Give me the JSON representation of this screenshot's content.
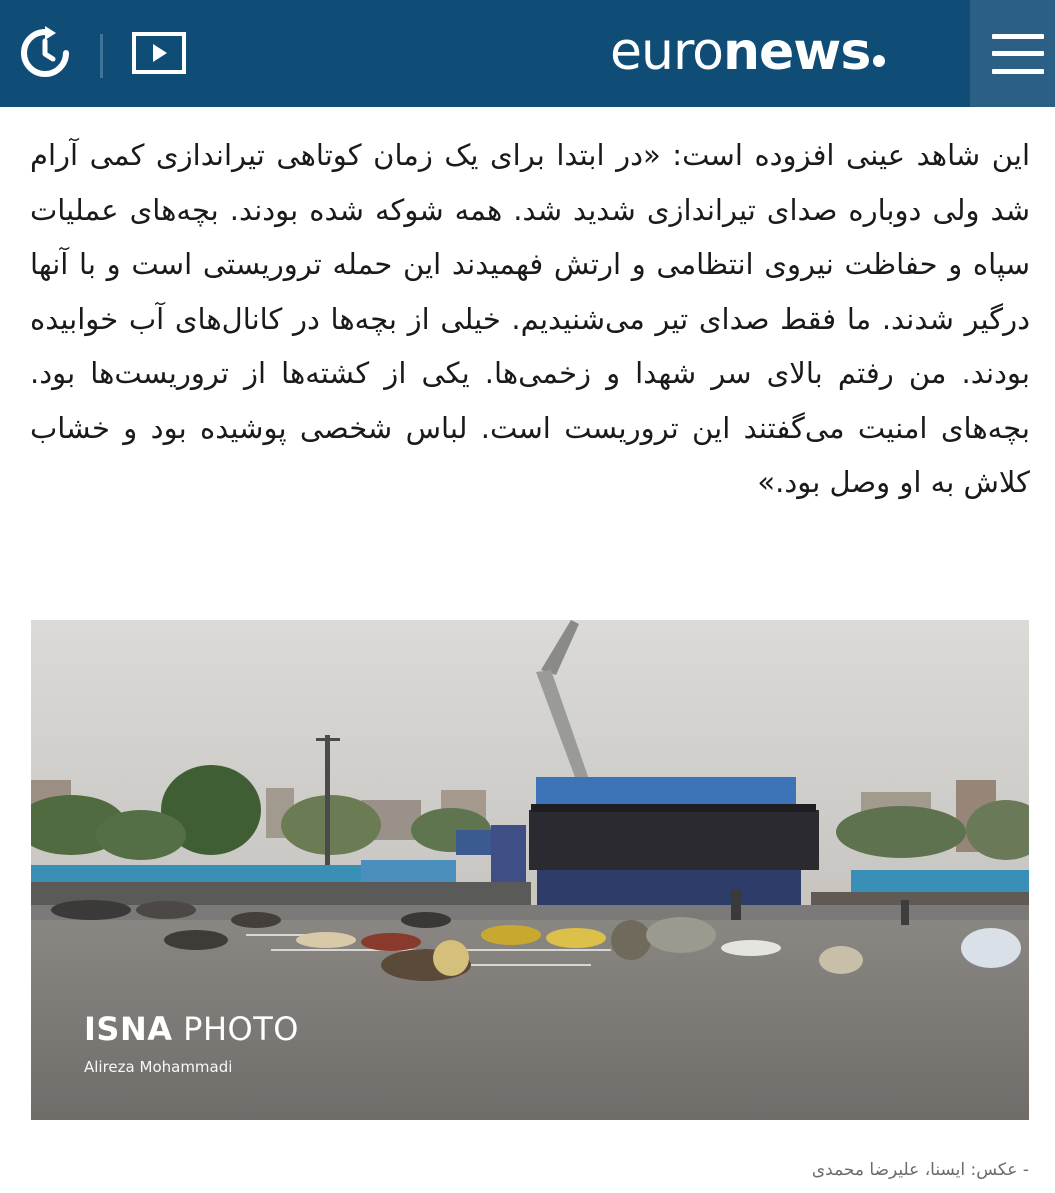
{
  "header": {
    "logo_light": "euro",
    "logo_bold": "news",
    "colors": {
      "bar": "#0f4d77",
      "menu_panel": "#2b5f86"
    },
    "icons": [
      "replay-icon",
      "video-play-icon",
      "hamburger-menu-icon"
    ]
  },
  "article": {
    "paragraph": "این شاهد عینی افزوده است: «در ابتدا برای یک زمان کوتاهی تیراندازی کمی آرام شد ولی دوباره صدای تیراندازی شدید شد. همه شوکه شده بودند. بچه‌های عملیات سپاه و حفاظت نیروی انتظامی و ارتش فهمیدند این حمله تروریستی است و با آنها درگیر شدند. ما فقط صدای تیر می‌شنیدیم. خیلی از بچه‌ها در کانال‌های آب خوابیده بودند. من رفتم بالای سر شهدا و زخمی‌ها. یکی از کشته‌ها از تروریست‌ها بود. بچه‌های امنیت می‌گفتند این تروریست است. لباس شخصی پوشیده بود و خشاب کلاش به او وصل بود.»"
  },
  "photo": {
    "watermark_bold": "ISNA",
    "watermark_light": " PHOTO",
    "photographer": "Alireza Mohammadi"
  },
  "caption": "- عکس: ایسنا، علیرضا محمدی"
}
